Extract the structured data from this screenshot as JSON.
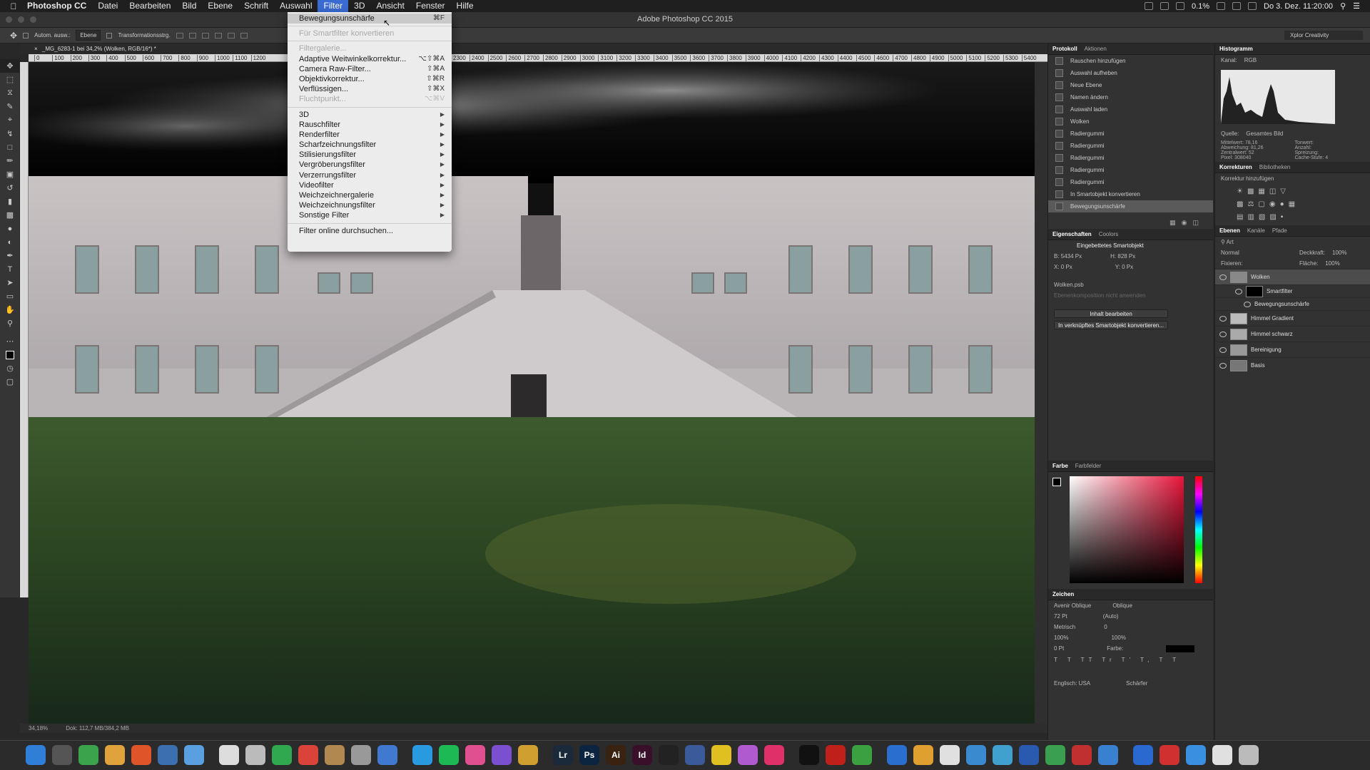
{
  "menubar": {
    "app": "Photoshop CC",
    "items": [
      "Datei",
      "Bearbeiten",
      "Bild",
      "Ebene",
      "Schrift",
      "Auswahl",
      "Filter",
      "3D",
      "Ansicht",
      "Fenster",
      "Hilfe"
    ],
    "active": "Filter",
    "battery": "0.1%",
    "datetime": "Do 3. Dez. 11:20:00"
  },
  "window": {
    "title": "Adobe Photoshop CC 2015"
  },
  "options": {
    "autoselect": "Autom. ausw.:",
    "layer_select": "Ebene",
    "transform": "Transformationsstrg.",
    "workspace": "Xplor Creativity"
  },
  "doc": {
    "tab": "_MG_6283-1 bei 34,2% (Wolken, RGB/16*) *",
    "zoom": "34,18%",
    "status": "Dok: 112,7 MB/384,2 MB"
  },
  "ruler": [
    "0",
    "100",
    "200",
    "300",
    "400",
    "500",
    "600",
    "700",
    "800",
    "900",
    "1000",
    "1100",
    "1200",
    "2300",
    "2400",
    "2500",
    "2600",
    "2700",
    "2800",
    "2900",
    "3000",
    "3100",
    "3200",
    "3300",
    "3400",
    "3500",
    "3600",
    "3700",
    "3800",
    "3900",
    "4000",
    "4100",
    "4200",
    "4300",
    "4400",
    "4500",
    "4600",
    "4700",
    "4800",
    "4900",
    "5000",
    "5100",
    "5200",
    "5300",
    "5400"
  ],
  "filter_menu": {
    "items": [
      {
        "label": "Bewegungsunschärfe",
        "shortcut": "⌘F",
        "state": "highlight"
      },
      {
        "sep": true
      },
      {
        "label": "Für Smartfilter konvertieren",
        "shortcut": "",
        "state": "disabled"
      },
      {
        "sep": true
      },
      {
        "label": "Filtergalerie...",
        "shortcut": "",
        "state": "disabled"
      },
      {
        "label": "Adaptive Weitwinkelkorrektur...",
        "shortcut": "⌥⇧⌘A",
        "state": "normal"
      },
      {
        "label": "Camera Raw-Filter...",
        "shortcut": "⇧⌘A",
        "state": "normal"
      },
      {
        "label": "Objektivkorrektur...",
        "shortcut": "⇧⌘R",
        "state": "normal"
      },
      {
        "label": "Verflüssigen...",
        "shortcut": "⇧⌘X",
        "state": "normal"
      },
      {
        "label": "Fluchtpunkt...",
        "shortcut": "⌥⌘V",
        "state": "disabled"
      },
      {
        "sep": true
      },
      {
        "label": "3D",
        "shortcut": "",
        "state": "submenu"
      },
      {
        "label": "Rauschfilter",
        "shortcut": "",
        "state": "submenu"
      },
      {
        "label": "Renderfilter",
        "shortcut": "",
        "state": "submenu"
      },
      {
        "label": "Scharfzeichnungsfilter",
        "shortcut": "",
        "state": "submenu"
      },
      {
        "label": "Stilisierungsfilter",
        "shortcut": "",
        "state": "submenu"
      },
      {
        "label": "Vergröberungsfilter",
        "shortcut": "",
        "state": "submenu"
      },
      {
        "label": "Verzerrungsfilter",
        "shortcut": "",
        "state": "submenu"
      },
      {
        "label": "Videofilter",
        "shortcut": "",
        "state": "submenu"
      },
      {
        "label": "Weichzeichnergalerie",
        "shortcut": "",
        "state": "submenu"
      },
      {
        "label": "Weichzeichnungsfilter",
        "shortcut": "",
        "state": "submenu"
      },
      {
        "label": "Sonstige Filter",
        "shortcut": "",
        "state": "submenu"
      },
      {
        "sep": true
      },
      {
        "label": "Filter online durchsuchen...",
        "shortcut": "",
        "state": "normal"
      }
    ]
  },
  "protokoll": {
    "tabs": [
      "Protokoll",
      "Aktionen"
    ],
    "items": [
      "Rauschen hinzufügen",
      "Auswahl aufheben",
      "Neue Ebene",
      "Namen ändern",
      "Auswahl laden",
      "Wolken",
      "Radiergummi",
      "Radiergummi",
      "Radiergummi",
      "Radiergummi",
      "Radiergummi",
      "In Smartobjekt konvertieren",
      "Bewegungsunschärfe"
    ]
  },
  "eigenschaften": {
    "tabs": [
      "Eigenschaften",
      "Coolors"
    ],
    "type": "Eingebettetes Smartobjekt",
    "w": "B: 5434 Px",
    "h": "H: 828 Px",
    "x": "X: 0 Px",
    "y": "Y: 0 Px",
    "file": "Wolken.psb",
    "comp": "Ebenenkomposition nicht anwenden",
    "btn1": "Inhalt bearbeiten",
    "btn2": "In verknüpftes Smartobjekt konvertieren..."
  },
  "farbe": {
    "tabs": [
      "Farbe",
      "Farbfelder"
    ]
  },
  "zeichen": {
    "title": "Zeichen",
    "font": "Avenir Oblique",
    "style": "Oblique",
    "size": "72 Pt",
    "leading": "(Auto)",
    "kerning": "Metrisch",
    "tracking": "0",
    "vscale": "100%",
    "hscale": "100%",
    "baseline": "0 Pt",
    "color_label": "Farbe:",
    "lang": "Englisch: USA",
    "aa": "Schärfer"
  },
  "histogram": {
    "title": "Histogramm",
    "kanal_label": "Kanal:",
    "kanal": "RGB",
    "quelle_label": "Quelle:",
    "quelle": "Gesamtes Bild",
    "stats": [
      "Mittelwert: 78,16",
      "Tonwert:",
      "Abweichung: 81,26",
      "Anzahl:",
      "Zentralwert: 52",
      "Spreizung:",
      "Pixel: 308040",
      "Cache-Stufe: 4"
    ]
  },
  "korrekturen": {
    "tabs": [
      "Korrekturen",
      "Bibliotheken"
    ],
    "hint": "Korrektur hinzufügen"
  },
  "ebenen": {
    "tabs": [
      "Ebenen",
      "Kanäle",
      "Pfade"
    ],
    "filter": "Art",
    "mode": "Normal",
    "opacity_label": "Deckkraft:",
    "opacity": "100%",
    "fill_label": "Fläche:",
    "fill": "100%",
    "lock_label": "Fixieren:",
    "layers": [
      {
        "name": "Wolken",
        "kind": "layer",
        "sel": true
      },
      {
        "name": "Smartfilter",
        "kind": "sub"
      },
      {
        "name": "Bewegungsunschärfe",
        "kind": "sub2"
      },
      {
        "name": "Himmel Gradient",
        "kind": "layer"
      },
      {
        "name": "Himmel schwarz",
        "kind": "layer"
      },
      {
        "name": "Bereinigung",
        "kind": "layer"
      },
      {
        "name": "Basis",
        "kind": "layer"
      }
    ]
  },
  "dock": {
    "apps": [
      {
        "label": "",
        "color": "#2f7fd9"
      },
      {
        "label": "",
        "color": "#555"
      },
      {
        "label": "",
        "color": "#3aa34b"
      },
      {
        "label": "",
        "color": "#e0a23a"
      },
      {
        "label": "",
        "color": "#e0542a"
      },
      {
        "label": "",
        "color": "#3a6fb0"
      },
      {
        "label": "",
        "color": "#5aa0e0"
      },
      {
        "label": "",
        "color": "#ddd"
      },
      {
        "label": "",
        "color": "#bbb"
      },
      {
        "label": "",
        "color": "#2fa84f"
      },
      {
        "label": "",
        "color": "#d9433a"
      },
      {
        "label": "",
        "color": "#b08850"
      },
      {
        "label": "",
        "color": "#999"
      },
      {
        "label": "",
        "color": "#3f7ad0"
      },
      {
        "label": "",
        "color": "#2a9ae0"
      },
      {
        "label": "",
        "color": "#1db954"
      },
      {
        "label": "",
        "color": "#e05090"
      },
      {
        "label": "",
        "color": "#7a4fd0"
      },
      {
        "label": "",
        "color": "#cfa030"
      },
      {
        "label": "Lr",
        "color": "#1b2a3a"
      },
      {
        "label": "Ps",
        "color": "#0b2540"
      },
      {
        "label": "Ai",
        "color": "#3a2210"
      },
      {
        "label": "Id",
        "color": "#3a0f2a"
      },
      {
        "label": "",
        "color": "#222"
      },
      {
        "label": "",
        "color": "#3a5a9a"
      },
      {
        "label": "",
        "color": "#e0c020"
      },
      {
        "label": "",
        "color": "#b05ad0"
      },
      {
        "label": "",
        "color": "#e0306a"
      },
      {
        "label": "",
        "color": "#111"
      },
      {
        "label": "",
        "color": "#c0201a"
      },
      {
        "label": "",
        "color": "#3aa040"
      },
      {
        "label": "",
        "color": "#2a6fd0"
      },
      {
        "label": "",
        "color": "#e0a030"
      },
      {
        "label": "",
        "color": "#e0e0e0"
      },
      {
        "label": "",
        "color": "#3a8ad0"
      },
      {
        "label": "",
        "color": "#40a0d0"
      },
      {
        "label": "",
        "color": "#2a5ab0"
      },
      {
        "label": "",
        "color": "#3aa050"
      },
      {
        "label": "",
        "color": "#c03030"
      },
      {
        "label": "",
        "color": "#3a80d0"
      },
      {
        "label": "",
        "color": "#2a6ad0"
      },
      {
        "label": "",
        "color": "#d03030"
      },
      {
        "label": "",
        "color": "#3a90e0"
      },
      {
        "label": "",
        "color": "#e0e0e0"
      },
      {
        "label": "",
        "color": "#bbb"
      }
    ]
  }
}
